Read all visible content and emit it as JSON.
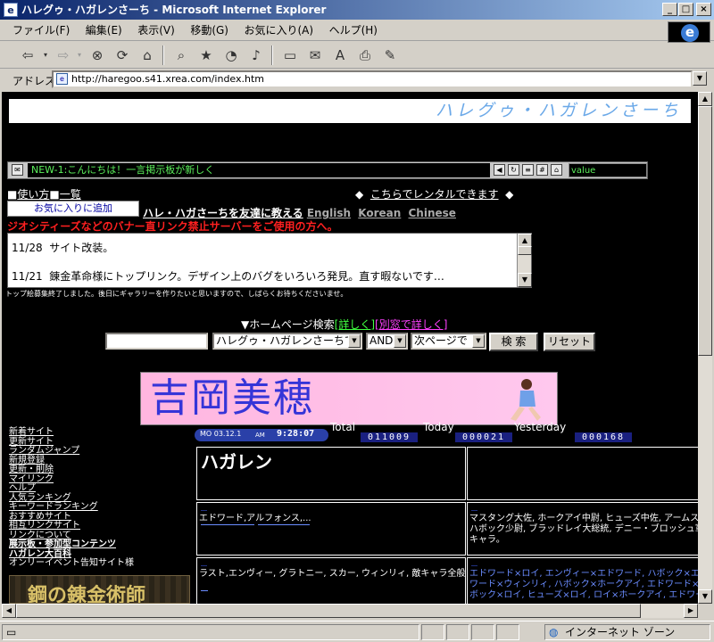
{
  "window": {
    "title": "ハレグゥ・ハガレンさーち - Microsoft Internet Explorer"
  },
  "menu": [
    "ファイル(F)",
    "編集(E)",
    "表示(V)",
    "移動(G)",
    "お気に入り(A)",
    "ヘルプ(H)"
  ],
  "address": {
    "label": "アドレス",
    "url": "http://haregoo.s41.xrea.com/index.htm"
  },
  "status": {
    "zone": "インターネット ゾーン"
  },
  "page": {
    "banner_title": "ハレグゥ・ハガレンさーち",
    "ticker_text": "NEW-1:こんにちは！一言掲示板が新しく",
    "ticker_value": "value",
    "usage": "使い方",
    "list": "一覧",
    "rental_text": "こちらでレンタルできます",
    "popup_text": "お気に入りに追加",
    "tell_friend": "ハレ・ハガさーちを友達に教える",
    "languages": [
      "English",
      "Korean",
      "Chinese"
    ],
    "warning": "ジオシティーズなどのバナー直リンク禁止サーバーをご使用の方へ。",
    "news": [
      {
        "date": "11/28",
        "text": "サイト改装。"
      },
      {
        "date": "11/21",
        "text": "錬金革命様にトップリンク。デザイン上のバグをいろいろ発見。直す暇ないです…"
      }
    ],
    "note": "トップ絵募集終了しました。後日にギャラリーを作りたいと思いますので、しばらくお待ちくださいませ。",
    "search": {
      "title": "▼ホームページ検索",
      "detail1": "[詳しく]",
      "detail2": "[別窓で詳しく]",
      "scope": "ハレグゥ・ハガレンさーちで",
      "mode": "AND",
      "pager": "次ページで",
      "search_btn": "検 索",
      "reset_btn": "リセット"
    },
    "ad_name": "吉岡美穂",
    "clock": {
      "date": "MO 03.12.1",
      "ampm": "AM",
      "time": "9:28:07"
    },
    "counters": {
      "total_label": "Total",
      "total": "011009",
      "today_label": "Today",
      "today": "000021",
      "yesterday_label": "Yesterday",
      "yesterday": "000168"
    },
    "nav": [
      "新着サイト",
      "更新サイト",
      "ランダムジャンプ",
      "新規登録",
      "更新・削除",
      "マイリンク",
      "ヘルプ",
      "人気ランキング",
      "キーワードランキング",
      "おすすめサイト",
      "相互リンクサイト",
      "リンクについて",
      "展示板・参加型コンテンツ",
      "ハガレン大百科",
      "オンリーイベント告知サイト様"
    ],
    "section_title": "ハガレン",
    "box1_text": "エドワード,アルフォンス,...",
    "box2_text": "マスタング大佐, ホークアイ中尉, ヒューズ中佐, アームストロ",
    "box2_text2": "ハボック少尉, ブラッドレイ大総統, デニー・ブロッシュ軍曹, そ",
    "box2_text3": "キャラ。",
    "box3_text": "ラスト,エンヴィー, グラトニー, スカー, ウィンリィ, 敵キャラ全般, その他,",
    "box4_text": "エドワード×ロイ, エンヴィー×エドワード, ハボック×エドワ",
    "box4_text2": "ワード×ウィンリィ, ハボック×ホークアイ, エドワード×ホーク",
    "box4_text3": "ボック×ロイ, ヒューズ×ロイ, ロイ×ホークアイ, エドワード×ホ",
    "fm_logo": "鋼の錬金術師"
  }
}
